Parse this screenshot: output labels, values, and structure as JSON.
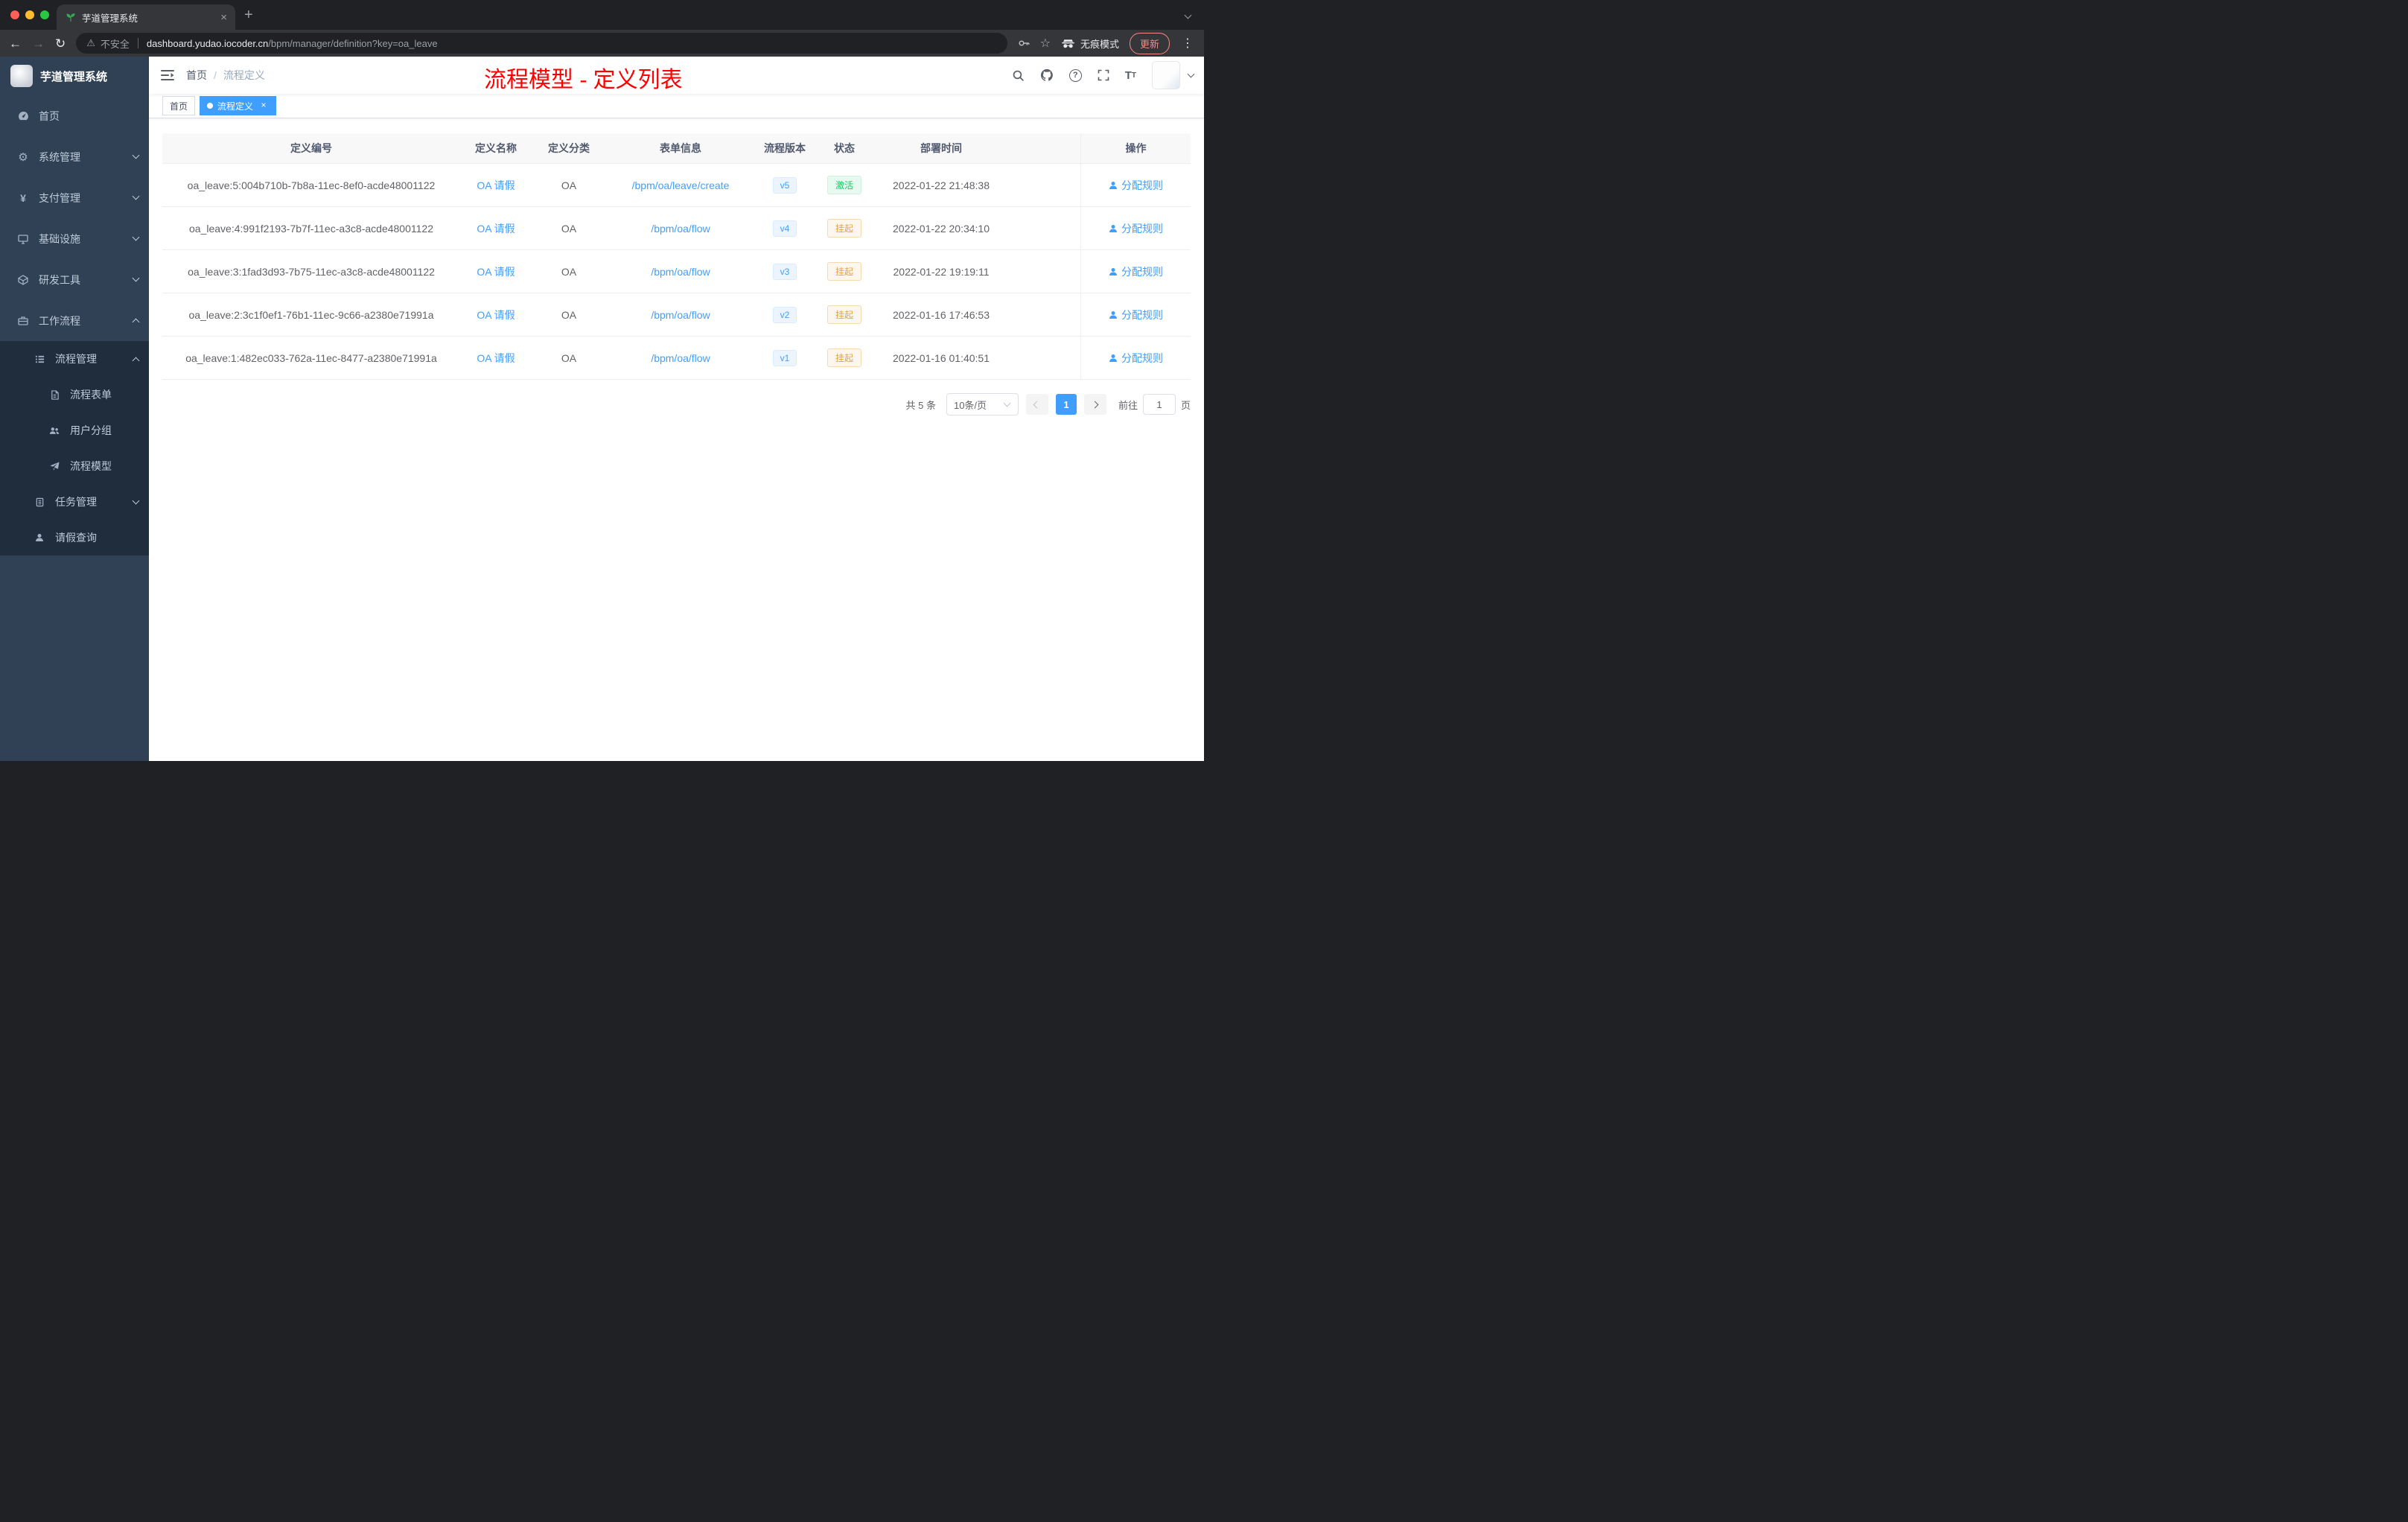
{
  "browser": {
    "tab_title": "芋道管理系统",
    "new_tab": "+",
    "security_label": "不安全",
    "url_host": "dashboard.yudao.iocoder.cn",
    "url_path": "/bpm/manager/definition?key=oa_leave",
    "incognito_label": "无痕模式",
    "update_label": "更新"
  },
  "sidebar": {
    "logo_title": "芋道管理系统",
    "items": [
      "首页",
      "系统管理",
      "支付管理",
      "基础设施",
      "研发工具",
      "工作流程"
    ],
    "submenu": [
      "流程管理",
      "流程表单",
      "用户分组",
      "流程模型",
      "任务管理",
      "请假查询"
    ]
  },
  "header": {
    "breadcrumb": [
      "首页",
      "流程定义"
    ],
    "separator": "/",
    "annotation": "流程模型 - 定义列表"
  },
  "tags": {
    "home": "首页",
    "active": "流程定义"
  },
  "table": {
    "columns": [
      "定义编号",
      "定义名称",
      "定义分类",
      "表单信息",
      "流程版本",
      "状态",
      "部署时间",
      "操作"
    ],
    "rows": [
      {
        "id": "oa_leave:5:004b710b-7b8a-11ec-8ef0-acde48001122",
        "name": "OA 请假",
        "category": "OA",
        "form": "/bpm/oa/leave/create",
        "version": "v5",
        "status": {
          "label": "激活",
          "type": "success"
        },
        "time": "2022-01-22 21:48:38",
        "action": "分配规则"
      },
      {
        "id": "oa_leave:4:991f2193-7b7f-11ec-a3c8-acde48001122",
        "name": "OA 请假",
        "category": "OA",
        "form": "/bpm/oa/flow",
        "version": "v4",
        "status": {
          "label": "挂起",
          "type": "warning"
        },
        "time": "2022-01-22 20:34:10",
        "action": "分配规则"
      },
      {
        "id": "oa_leave:3:1fad3d93-7b75-11ec-a3c8-acde48001122",
        "name": "OA 请假",
        "category": "OA",
        "form": "/bpm/oa/flow",
        "version": "v3",
        "status": {
          "label": "挂起",
          "type": "warning"
        },
        "time": "2022-01-22 19:19:11",
        "action": "分配规则"
      },
      {
        "id": "oa_leave:2:3c1f0ef1-76b1-11ec-9c66-a2380e71991a",
        "name": "OA 请假",
        "category": "OA",
        "form": "/bpm/oa/flow",
        "version": "v2",
        "status": {
          "label": "挂起",
          "type": "warning"
        },
        "time": "2022-01-16 17:46:53",
        "action": "分配规则"
      },
      {
        "id": "oa_leave:1:482ec033-762a-11ec-8477-a2380e71991a",
        "name": "OA 请假",
        "category": "OA",
        "form": "/bpm/oa/flow",
        "version": "v1",
        "status": {
          "label": "挂起",
          "type": "warning"
        },
        "time": "2022-01-16 01:40:51",
        "action": "分配规则"
      }
    ]
  },
  "pagination": {
    "total": "共 5 条",
    "page_size": "10条/页",
    "current_page": "1",
    "goto_prefix": "前往",
    "goto_value": "1",
    "goto_suffix": "页"
  },
  "colors": {
    "accent": "#409eff",
    "annotation_red": "#ff0000",
    "success": "#13ce66",
    "warning": "#e6a23c",
    "sidebar_bg": "#304156",
    "submenu_bg": "#1f2d3d"
  }
}
